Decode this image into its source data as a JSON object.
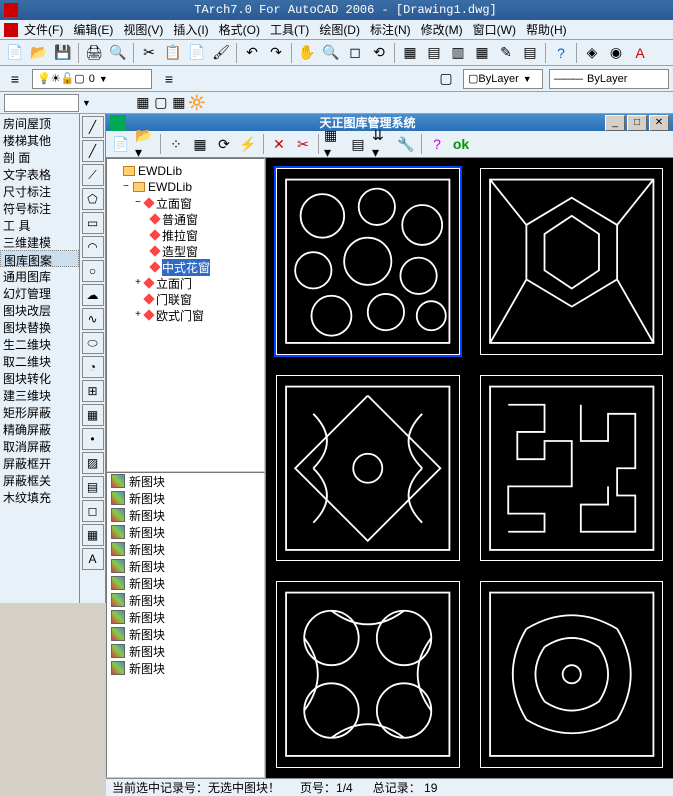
{
  "app": {
    "title": "TArch7.0 For AutoCAD 2006 - [Drawing1.dwg]"
  },
  "menu": {
    "items": [
      "文件(F)",
      "编辑(E)",
      "视图(V)",
      "插入(I)",
      "格式(O)",
      "工具(T)",
      "绘图(D)",
      "标注(N)",
      "修改(M)",
      "窗口(W)",
      "帮助(H)"
    ]
  },
  "layer": {
    "bylayer1": "ByLayer",
    "bylayer2": "ByLayer",
    "zero": "0"
  },
  "sidebar": {
    "items": [
      "房间屋顶",
      "楼梯其他",
      "剖  面",
      "文字表格",
      "尺寸标注",
      "符号标注",
      "工  具",
      "三维建模",
      "图库图案",
      "通用图库",
      "幻灯管理",
      "图块改层",
      "图块替换",
      "生二维块",
      "取二维块",
      "图块转化",
      "建三维块",
      "矩形屏蔽",
      "精确屏蔽",
      "取消屏蔽",
      "屏蔽框开",
      "屏蔽框关",
      "木纹填充"
    ]
  },
  "dialog": {
    "title": "天正图库管理系统",
    "tree": {
      "root": "EWDLib",
      "lib": "EWDLib",
      "category": "立面窗",
      "items": [
        "普通窗",
        "推拉窗",
        "造型窗",
        "中式花窗"
      ],
      "siblings": [
        "立面门",
        "门联窗",
        "欧式门窗"
      ]
    },
    "list_item": "新图块",
    "status": {
      "record": "当前选中记录号：无选中图块！",
      "page": "页号：1/4",
      "total": "总记录：  19"
    }
  }
}
